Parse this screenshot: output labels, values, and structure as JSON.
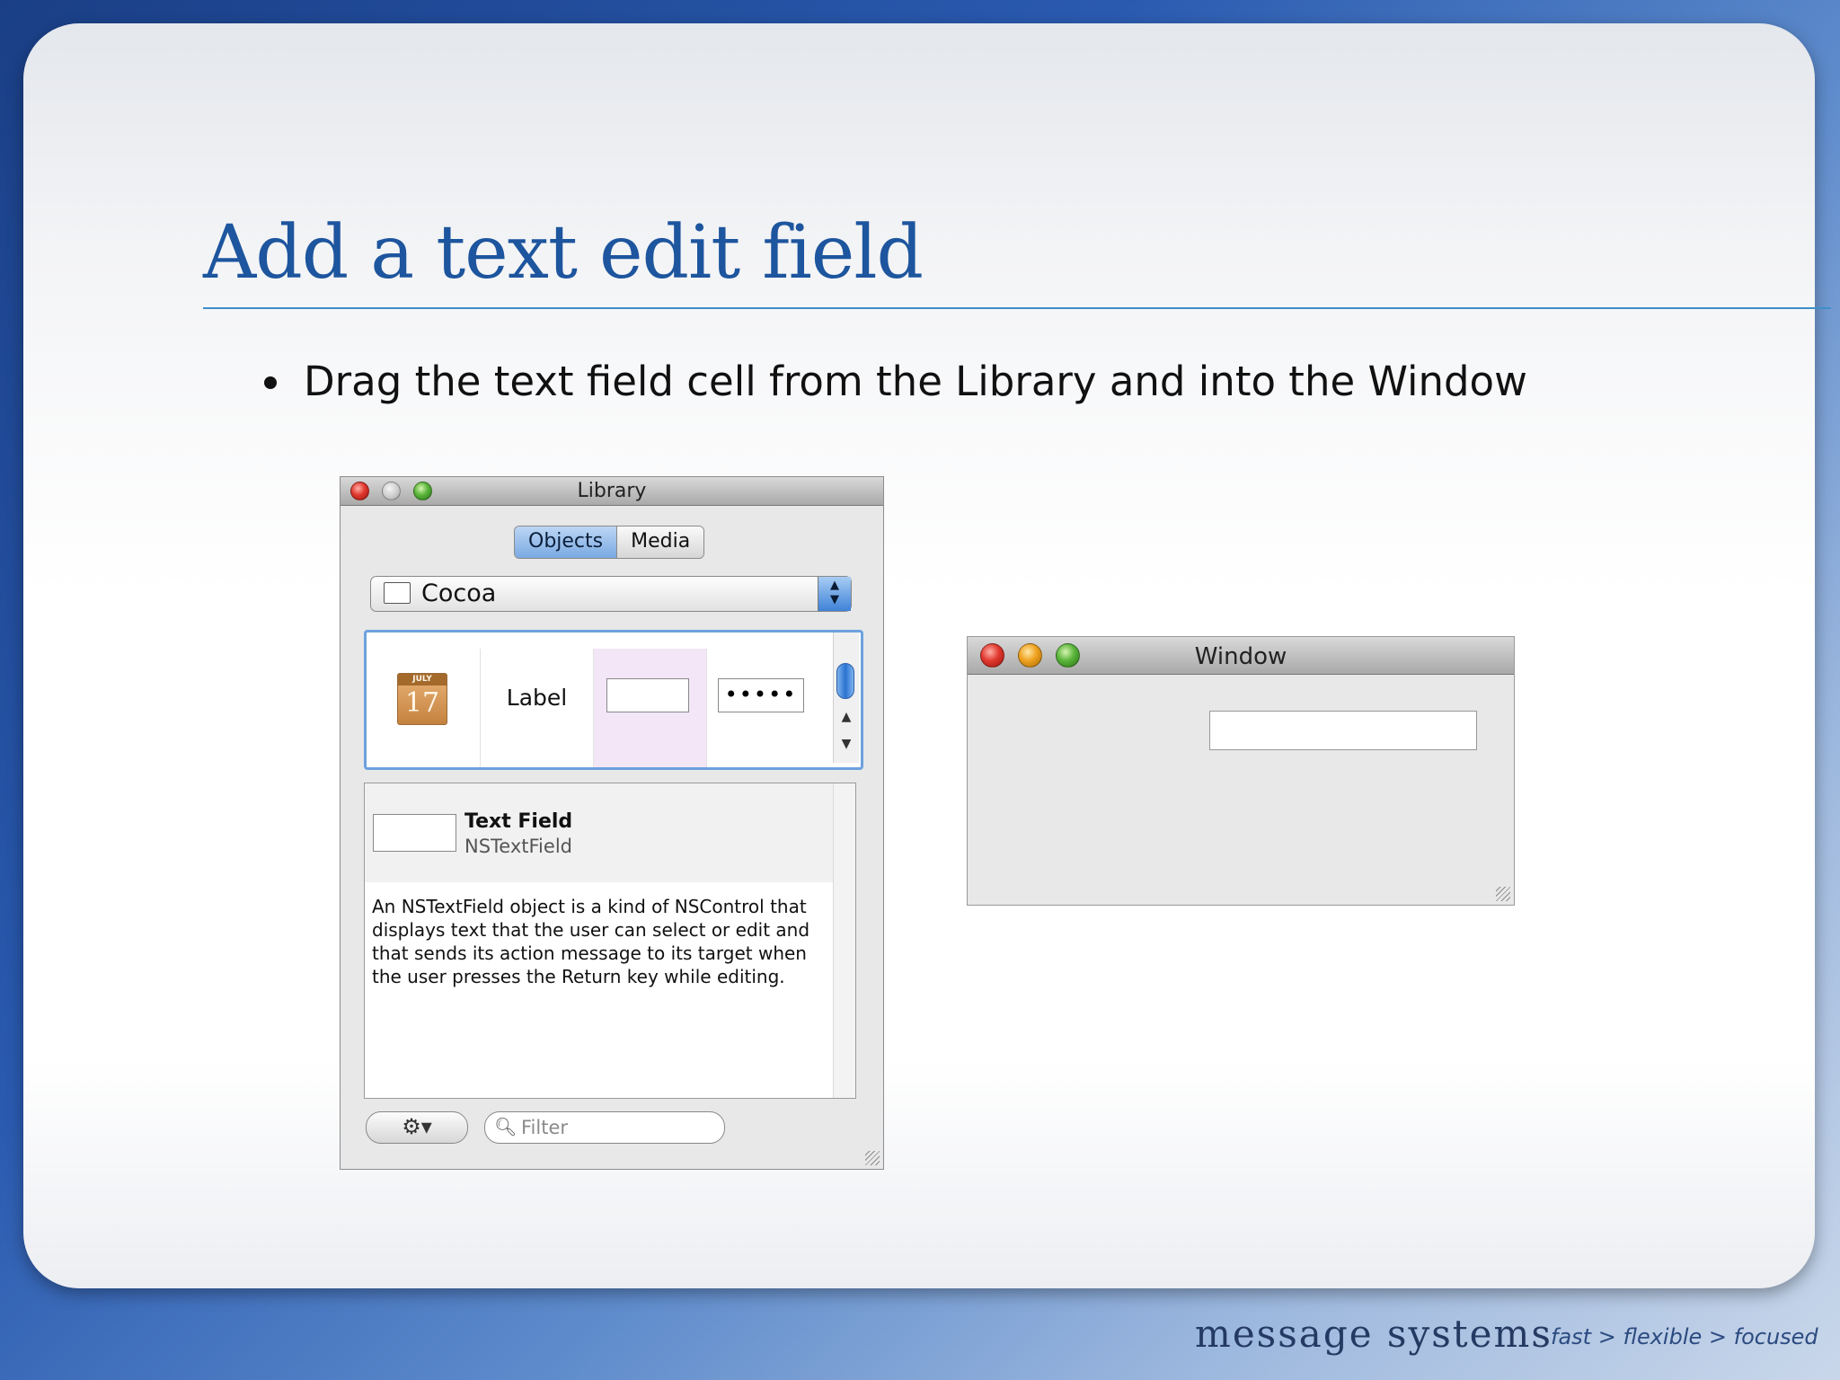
{
  "slide": {
    "title": "Add a text edit field",
    "bullet": "Drag the text field cell from the Library and into the Window"
  },
  "library": {
    "window_title": "Library",
    "tabs": [
      {
        "label": "Objects",
        "selected": true
      },
      {
        "label": "Media",
        "selected": false
      }
    ],
    "group_selected": "Cocoa",
    "grid_items": [
      {
        "name": "date-picker",
        "icon": "calendar-icon",
        "month": "JULY",
        "day": "17"
      },
      {
        "name": "label",
        "text": "Label"
      },
      {
        "name": "text-field",
        "selected": true
      },
      {
        "name": "secure-text-field",
        "text": "•••••"
      }
    ],
    "detail": {
      "name": "Text Field",
      "class_name": "NSTextField",
      "description": "An NSTextField object is a kind of NSControl that displays text that the user can select or edit and that sends its action message to its target when the user presses the Return key while editing."
    },
    "filter_placeholder": "Filter",
    "action_icon": "gear-icon"
  },
  "window": {
    "title": "Window"
  },
  "footer": {
    "logo": "message systems",
    "tagline": "fast > flexible > focused"
  },
  "colors": {
    "title": "#1d559e",
    "rule": "#3f8ec9",
    "selection": "#6ca1de"
  }
}
